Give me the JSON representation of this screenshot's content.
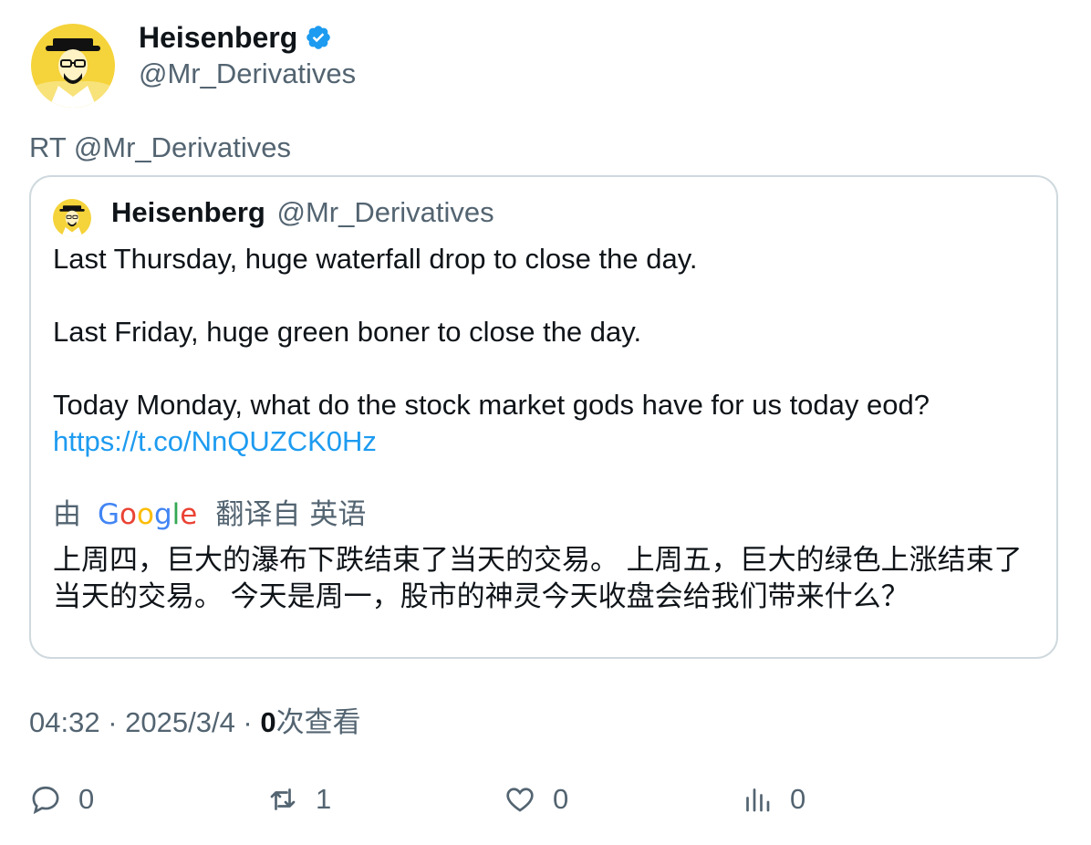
{
  "author": {
    "display_name": "Heisenberg",
    "handle": "@Mr_Derivatives",
    "verified": true,
    "avatar_icon": "heisenberg-avatar-icon"
  },
  "retweet_text": "RT @Mr_Derivatives",
  "quoted_tweet": {
    "display_name": "Heisenberg",
    "handle": "@Mr_Derivatives",
    "paragraph_1": "Last Thursday, huge waterfall drop to close the day.",
    "paragraph_2": "Last Friday, huge green boner to close the day.",
    "paragraph_3": "Today Monday, what do the stock market gods have for us today eod?",
    "link": "https://t.co/NnQUZCK0Hz",
    "translation": {
      "by_label": "由",
      "provider": "Google",
      "from_label": "翻译自",
      "language": "英语",
      "text": "上周四，巨大的瀑布下跌结束了当天的交易。 上周五，巨大的绿色上涨结束了当天的交易。 今天是周一，股市的神灵今天收盘会给我们带来什么？"
    }
  },
  "meta": {
    "time": "04:32",
    "separator": " · ",
    "date": "2025/3/4",
    "views_count": "0",
    "views_label": "次查看"
  },
  "actions": {
    "reply_count": "0",
    "retweet_count": "1",
    "like_count": "0",
    "views_count": "0"
  },
  "colors": {
    "text_primary": "#0f1419",
    "text_secondary": "#536471",
    "link": "#1d9bf0",
    "border": "#cfd9de",
    "verified": "#1d9bf0"
  }
}
